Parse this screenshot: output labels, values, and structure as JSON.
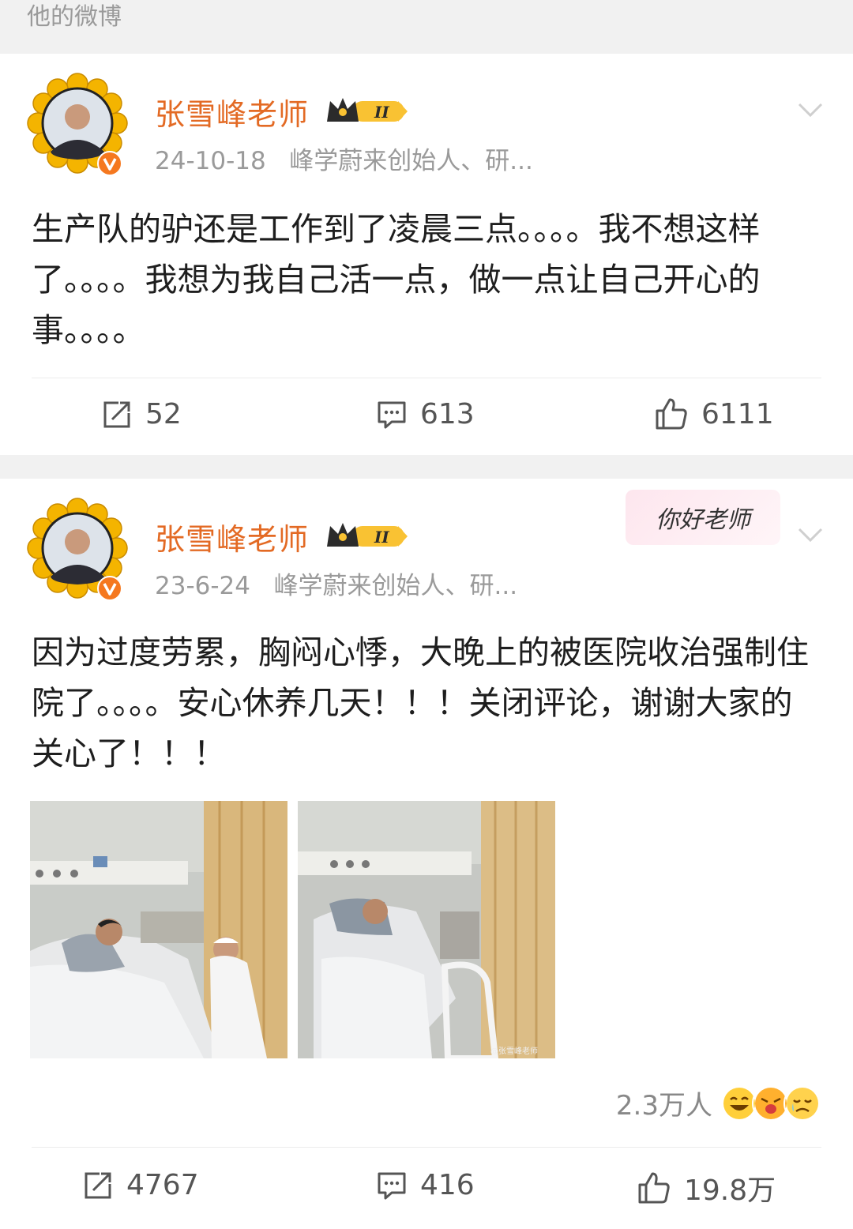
{
  "header": {
    "title": "他的微博"
  },
  "posts": [
    {
      "author": "张雪峰老师",
      "vip_level": "II",
      "date": "24-10-18",
      "bio": "峰学蔚来创始人、研...",
      "text": "生产队的驴还是工作到了凌晨三点。。。。我不想这样了。。。。我想为我自己活一点，做一点让自己开心的事。。。。",
      "reposts": "52",
      "comments": "613",
      "likes": "6111"
    },
    {
      "author": "张雪峰老师",
      "vip_level": "II",
      "date": "23-6-24",
      "bio": "峰学蔚来创始人、研...",
      "sticker": "你好老师",
      "text": "因为过度劳累，胸闷心悸，大晚上的被医院收治强制住院了。。。。安心休养几天！！！关闭评论，谢谢大家的关心了！！！",
      "watermark": "@张雪峰老师",
      "reaction_count": "2.3万人",
      "reposts": "4767",
      "comments": "416",
      "likes": "19.8万"
    }
  ],
  "icons": {
    "repost": "repost-icon",
    "comment": "comment-icon",
    "like": "like-icon",
    "chevron": "chevron-down-icon",
    "verified": "verified-badge-icon",
    "crown": "vip-crown-icon"
  },
  "colors": {
    "name": "#e36a24",
    "verified": "#f5781f",
    "meta": "#9a9a9a",
    "background": "#f1f1f1"
  }
}
